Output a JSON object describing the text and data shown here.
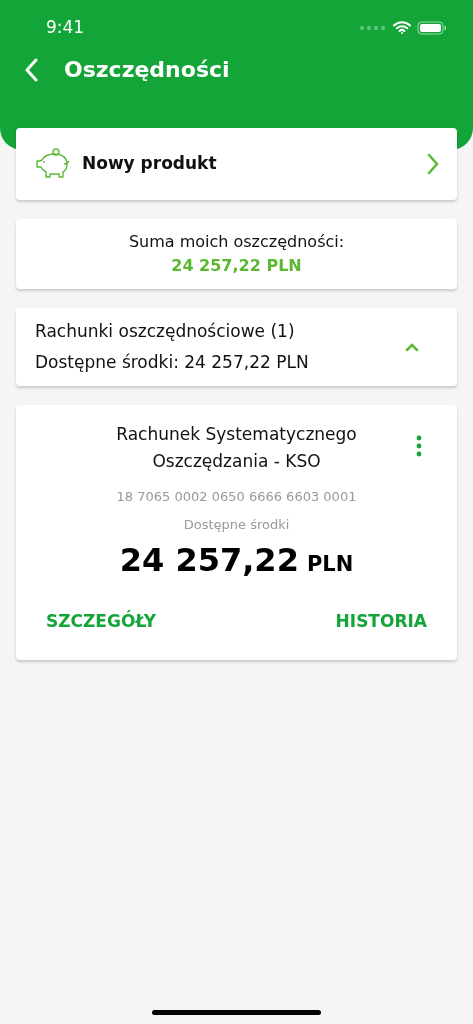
{
  "status_bar": {
    "time": "9:41"
  },
  "header": {
    "title": "Oszczędności"
  },
  "new_product": {
    "label": "Nowy produkt"
  },
  "summary": {
    "label": "Suma moich oszczędności:",
    "amount": "24 257,22 PLN"
  },
  "section": {
    "title": "Rachunki oszczędnościowe (1)",
    "subtitle": "Dostępne środki: 24 257,22 PLN",
    "expanded": true
  },
  "accounts": [
    {
      "name": "Rachunek Systematycznego Oszczędzania - KSO",
      "number": "18 7065 0002 0650 6666 6603 0001",
      "balance_label": "Dostępne środki",
      "balance": "24 257,22",
      "currency": "PLN",
      "actions": [
        "SZCZEGÓŁY",
        "HISTORIA"
      ]
    }
  ]
}
